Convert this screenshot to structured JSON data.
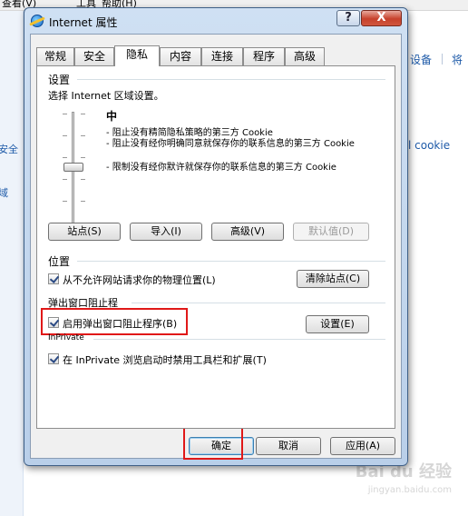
{
  "background": {
    "menubar": {
      "item_view": "查看(V)",
      "item_tools": "工具",
      "item_help": "帮助(H)"
    },
    "links": {
      "devices": "设备",
      "separator": "|",
      "right_link": "将",
      "cookie": "l cookie"
    },
    "sidebar": {
      "security": "安全",
      "region": "域"
    },
    "watermark": {
      "brand": "Bai du 经验",
      "sub": "jingyan.baidu.com"
    }
  },
  "dialog": {
    "title": "Internet 属性",
    "help_button": "?",
    "close_button": "X",
    "tabs": [
      "常规",
      "安全",
      "隐私",
      "内容",
      "连接",
      "程序",
      "高级"
    ],
    "active_tab": "隐私",
    "settings": {
      "group_label": "设置",
      "instruction": "选择 Internet 区域设置。",
      "level": "中",
      "descriptions": [
        "- 阻止没有精简隐私策略的第三方 Cookie",
        "- 阻止没有经你明确同意就保存你的联系信息的第三方 Cookie",
        "- 限制没有经你默许就保存你的联系信息的第三方 Cookie"
      ],
      "buttons": {
        "sites": "站点(S)",
        "import": "导入(I)",
        "advanced": "高级(V)",
        "default": "默认值(D)"
      }
    },
    "location": {
      "group_label": "位置",
      "checkbox_label": "从不允许网站请求你的物理位置(L)",
      "checked": true,
      "clear_button": "清除站点(C)"
    },
    "popup": {
      "group_label": "弹出窗口阻止程",
      "checkbox_label": "启用弹出窗口阻止程序(B)",
      "checked": true,
      "settings_button": "设置(E)"
    },
    "inprivate": {
      "group_label": "InPrivate",
      "checkbox_label": "在 InPrivate 浏览启动时禁用工具栏和扩展(T)",
      "checked": true
    },
    "footer": {
      "ok": "确定",
      "cancel": "取消",
      "apply": "应用(A)"
    }
  },
  "colors": {
    "highlight": "#e01818",
    "link": "#1e5aa8",
    "title_bar": "#cfe0f3"
  }
}
